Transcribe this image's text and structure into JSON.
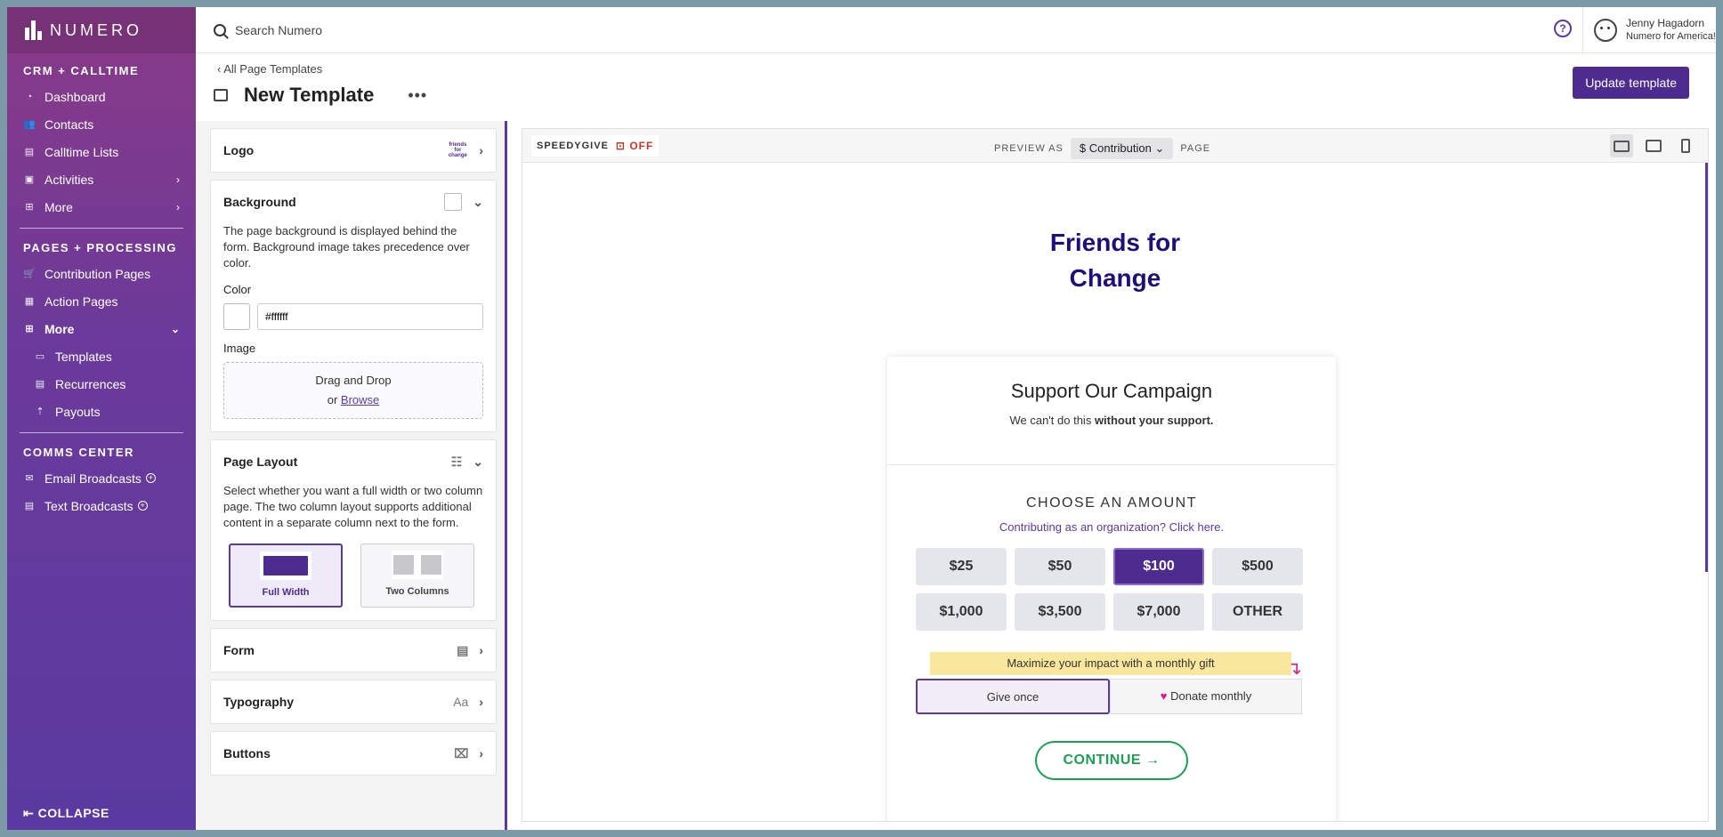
{
  "sidebar": {
    "logo": "NUMERO",
    "crm_title": "CRM + CALLTIME",
    "crm_items": [
      {
        "label": "Dashboard"
      },
      {
        "label": "Contacts"
      },
      {
        "label": "Calltime Lists"
      },
      {
        "label": "Activities"
      },
      {
        "label": "More"
      }
    ],
    "pages_title": "PAGES + PROCESSING",
    "pages_items": [
      {
        "label": "Contribution Pages"
      },
      {
        "label": "Action Pages"
      },
      {
        "label": "More"
      }
    ],
    "more_sub": [
      {
        "label": "Templates"
      },
      {
        "label": "Recurrences"
      },
      {
        "label": "Payouts"
      }
    ],
    "comms_title": "COMMS CENTER",
    "comms_items": [
      {
        "label": "Email Broadcasts"
      },
      {
        "label": "Text Broadcasts"
      }
    ],
    "collapse_label": "COLLAPSE"
  },
  "topbar": {
    "search_placeholder": "Search Numero",
    "help": "?",
    "user_name": "Jenny Hagadorn",
    "user_org": "Numero for America!"
  },
  "header": {
    "breadcrumb": "‹ All Page Templates",
    "title": "New Template",
    "more": "•••",
    "update_button": "Update template"
  },
  "panel": {
    "logo_label": "Logo",
    "logo_thumb": "friends for change",
    "background_label": "Background",
    "background_desc": "The page background is displayed behind the form. Background image takes precedence over color.",
    "color_label": "Color",
    "color_value": "#ffffff",
    "image_label": "Image",
    "drop_text": "Drag and Drop",
    "drop_or": "or",
    "drop_browse": "Browse",
    "layout_label": "Page Layout",
    "layout_desc": "Select whether you want a full width or two column page. The two column layout supports additional content in a separate column next to the form.",
    "layout_full": "Full Width",
    "layout_two": "Two Columns",
    "form_label": "Form",
    "typography_label": "Typography",
    "typography_icon": "Aa",
    "buttons_label": "Buttons"
  },
  "preview": {
    "speedygive": "SPEEDYGIVE",
    "off": "OFF",
    "preview_as": "PREVIEW AS",
    "preview_select": "Contribution",
    "preview_currency": "$",
    "page_word": "PAGE",
    "brand_line1": "Friends for",
    "brand_line2": "Change",
    "form_title": "Support Our Campaign",
    "form_sub_a": "We can't do this ",
    "form_sub_b": "without your support.",
    "choose": "CHOOSE AN AMOUNT",
    "org_link": "Contributing as an organization? Click here.",
    "amounts": [
      "$25",
      "$50",
      "$100",
      "$500",
      "$1,000",
      "$3,500",
      "$7,000",
      "OTHER"
    ],
    "selected_amount": "$100",
    "monthly_prompt": "Maximize your impact with a monthly gift",
    "give_once": "Give once",
    "donate_monthly": "Donate monthly",
    "continue": "CONTINUE"
  },
  "colors": {
    "accent": "#4e2b8f",
    "brand_navy": "#1f0f78",
    "green": "#1e9d55",
    "pink": "#d61f8a"
  }
}
